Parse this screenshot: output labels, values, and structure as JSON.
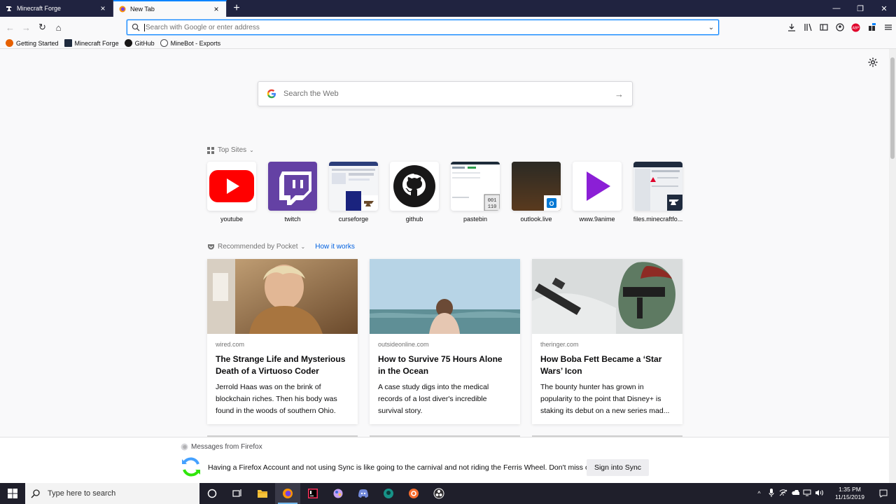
{
  "browser": {
    "tabs": [
      {
        "label": "Minecraft Forge",
        "active": false,
        "icon": "forge-anvil-icon"
      },
      {
        "label": "New Tab",
        "active": true,
        "icon": "firefox-icon"
      }
    ],
    "new_tab_symbol": "+",
    "window_controls": {
      "minimize": "—",
      "restore": "❐",
      "close": "✕"
    }
  },
  "navbar": {
    "back": "←",
    "forward": "→",
    "reload": "↻",
    "home": "⌂",
    "url_placeholder": "Search with Google or enter address",
    "dropdown": "⌄"
  },
  "bookmarks": [
    {
      "label": "Getting Started",
      "icon": "firefox-icon",
      "color": "#e66000"
    },
    {
      "label": "Minecraft Forge",
      "icon": "forge-anvil-icon",
      "color": "#1f2b3e"
    },
    {
      "label": "GitHub",
      "icon": "github-icon",
      "color": "#181717"
    },
    {
      "label": "MineBot - Exports",
      "icon": "globe-icon",
      "color": "#4a4a4f"
    }
  ],
  "newtab": {
    "search_placeholder": "Search the Web",
    "top_sites_label": "Top Sites",
    "top_sites": [
      {
        "name": "youtube",
        "icon": "youtube-icon"
      },
      {
        "name": "twitch",
        "icon": "twitch-icon"
      },
      {
        "name": "curseforge",
        "icon": "curseforge-thumbnail"
      },
      {
        "name": "github",
        "icon": "github-icon"
      },
      {
        "name": "pastebin",
        "icon": "pastebin-thumbnail"
      },
      {
        "name": "outlook.live",
        "icon": "outlook-thumbnail"
      },
      {
        "name": "www.9anime",
        "icon": "play-icon"
      },
      {
        "name": "files.minecraftfo...",
        "icon": "forge-thumbnail"
      }
    ],
    "pocket_label": "Recommended by Pocket",
    "how_it_works": "How it works",
    "stories": [
      {
        "source": "wired.com",
        "title": "The Strange Life and Mysterious Death of a Virtuoso Coder",
        "description": "Jerrold Haas was on the brink of blockchain riches. Then his body was found in the woods of southern Ohio."
      },
      {
        "source": "outsideonline.com",
        "title": "How to Survive 75 Hours Alone in the Ocean",
        "description": "A case study digs into the medical records of a lost diver's incredible survival story."
      },
      {
        "source": "theringer.com",
        "title": "How Boba Fett Became a ‘Star Wars’ Icon",
        "description": "The bounty hunter has grown in popularity to the point that Disney+ is staking its debut on a new series mad..."
      }
    ]
  },
  "message": {
    "header": "Messages from Firefox",
    "text": "Having a Firefox Account and not using Sync is like going to the carnival and not riding the Ferris Wheel. Don't miss out.",
    "button": "Sign into Sync"
  },
  "taskbar": {
    "search_placeholder": "Type here to search",
    "time": "1:35 PM",
    "date": "11/15/2019"
  },
  "colors": {
    "accent": "#0a84ff",
    "tabstrip": "#202340",
    "taskbar": "#1f1f2b",
    "link": "#0060df"
  }
}
